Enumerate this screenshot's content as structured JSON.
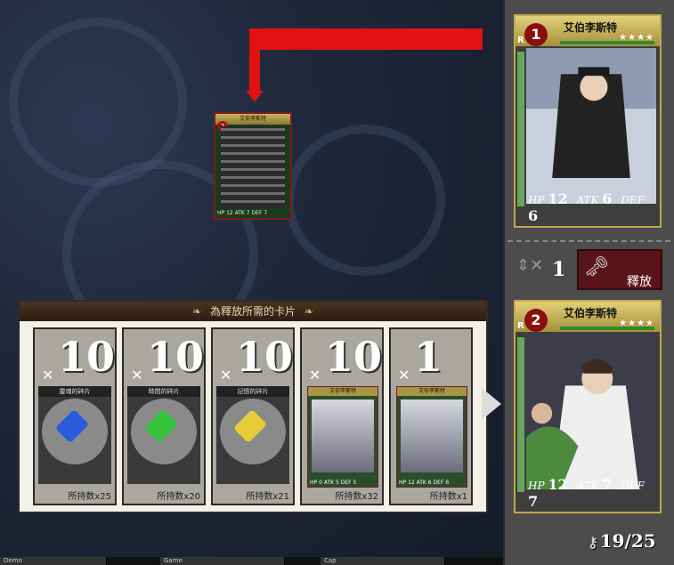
{
  "title_drop_card": "艾伯李斯特",
  "drop_card": {
    "rank": "2",
    "hp": "12",
    "atk": "7",
    "def": "7"
  },
  "panel": {
    "title": "為釋放所需的卡片",
    "orn_left": "❧",
    "orn_right": "❧"
  },
  "slots": [
    {
      "count": "10",
      "label": "靈魂的碎片",
      "owned": "所持数x25",
      "gem_color": "#2a5bdc"
    },
    {
      "count": "10",
      "label": "時間的碎片",
      "owned": "所持数x20",
      "gem_color": "#33c23a"
    },
    {
      "count": "10",
      "label": "記憶的碎片",
      "owned": "所持数x21",
      "gem_color": "#e6cc3a"
    },
    {
      "count": "10",
      "card_name": "艾伯李斯特",
      "rank": "2",
      "hp": "0",
      "atk": "5",
      "def": "5",
      "owned": "所持数x32"
    },
    {
      "count": "1",
      "card_name": "艾伯李斯特",
      "rank": "1",
      "hp": "12",
      "atk": "6",
      "def": "6",
      "owned": "所持数x1"
    }
  ],
  "side_top_card": {
    "rank": "1",
    "rank_label": "R",
    "name": "艾伯李斯特",
    "stars": "★★★★",
    "hp": "12",
    "atk": "6",
    "def": "6"
  },
  "side_bottom_card": {
    "rank": "2",
    "rank_label": "R",
    "name": "艾伯李斯特",
    "stars": "★★★★",
    "hp": "12",
    "atk": "7",
    "def": "7"
  },
  "multiplier": "1",
  "release_button": {
    "label": "釋放"
  },
  "pager": {
    "current": "19",
    "total": "25",
    "text": "19/25"
  },
  "stat_labels": {
    "hp": "HP",
    "atk": "ATK",
    "def": "DEF"
  },
  "taskbar": [
    "Demo",
    "Game",
    "Cap"
  ]
}
